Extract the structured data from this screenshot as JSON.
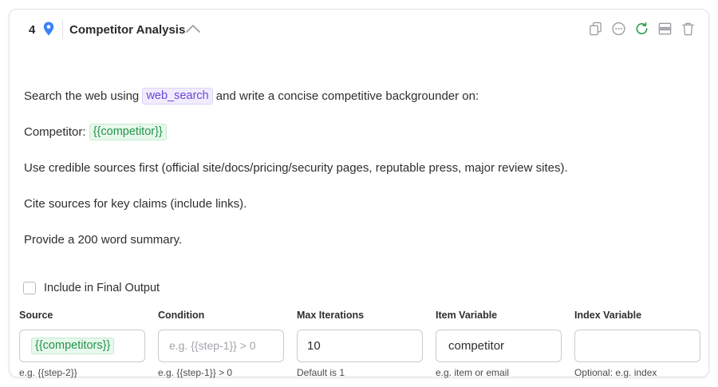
{
  "step": {
    "number": "4",
    "title": "Competitor Analysis"
  },
  "icons": {
    "pin": "map-pin-icon",
    "collapse": "chevron-up-icon",
    "actions": [
      "copy-icon",
      "more-icon",
      "refresh-icon",
      "split-icon",
      "trash-icon"
    ]
  },
  "colors": {
    "pin": "#3b82f6",
    "refresh": "#2a9d4f",
    "tool_chip_text": "#6a46d8",
    "variable_chip_text": "#23934a"
  },
  "prompt": {
    "line1_before": "Search the web using ",
    "line1_tool": "web_search",
    "line1_after": " and write a concise competitive backgrounder on:",
    "line2_label": "Competitor: ",
    "line2_variable": "{{competitor}}",
    "line3": "Use credible sources first (official site/docs/pricing/security pages, reputable press, major review sites).",
    "line4": "Cite sources for key claims (include links).",
    "line5": "Provide a 200 word summary."
  },
  "include_final_output": {
    "label": "Include in Final Output",
    "checked": false
  },
  "fields": {
    "source": {
      "label": "Source",
      "value": "{{competitors}}",
      "hint": "e.g. {{step-2}}"
    },
    "condition": {
      "label": "Condition",
      "placeholder": "e.g. {{step-1}} > 0",
      "hint": "e.g. {{step-1}} > 0"
    },
    "max_iterations": {
      "label": "Max Iterations",
      "value": "10",
      "hint": "Default is 1"
    },
    "item_variable": {
      "label": "Item Variable",
      "value": "competitor",
      "hint": "e.g. item or email"
    },
    "index_variable": {
      "label": "Index Variable",
      "value": "",
      "hint": "Optional: e.g. index"
    }
  }
}
